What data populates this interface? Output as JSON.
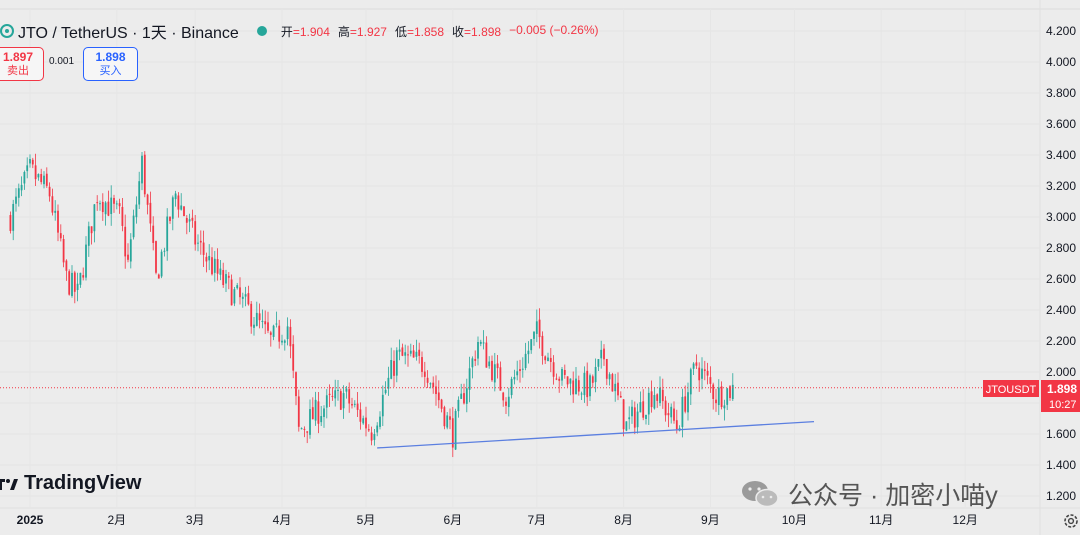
{
  "header": {
    "symbol": "JTO / TetherUS · 1天 · Binance",
    "ohlc": [
      {
        "label": "开",
        "value": "=1.904"
      },
      {
        "label": "高",
        "value": "=1.927"
      },
      {
        "label": "低",
        "value": "=1.858"
      },
      {
        "label": "收",
        "value": "=1.898"
      },
      {
        "label": "",
        "value": "−0.005 (−0.26%)"
      }
    ]
  },
  "trade": {
    "sell_price": "1.897",
    "sell_label": "卖出",
    "spread": "0.001",
    "buy_price": "1.898",
    "buy_label": "买入"
  },
  "price_tag": {
    "symbol": "JTOUSDT",
    "price": "1.898",
    "time": "10:27"
  },
  "branding": {
    "tradingview": "TradingView",
    "watermark": "公众号 · 加密小喵y"
  },
  "colors": {
    "up": "#26a69a",
    "down": "#f23645",
    "trendline": "#5b7fe0",
    "background": "#ececec"
  },
  "chart_data": {
    "type": "candlestick",
    "interval": "1天",
    "y_ticks": [
      4.2,
      4.0,
      3.8,
      3.6,
      3.4,
      3.2,
      3.0,
      2.8,
      2.6,
      2.4,
      2.2,
      2.0,
      1.8,
      1.6,
      1.4,
      1.2
    ],
    "y_tick_labels": [
      "4.200",
      "4.000",
      "3.800",
      "3.600",
      "3.400",
      "3.200",
      "3.000",
      "2.800",
      "2.600",
      "2.400",
      "2.200",
      "2.000",
      "1.800",
      "1.600",
      "1.400",
      "1.200"
    ],
    "x_labels": [
      {
        "label": "2025",
        "date": "2025-01-01"
      },
      {
        "label": "2月",
        "date": "2025-02-01"
      },
      {
        "label": "3月",
        "date": "2025-03-01"
      },
      {
        "label": "4月",
        "date": "2025-04-01"
      },
      {
        "label": "5月",
        "date": "2025-05-01"
      },
      {
        "label": "6月",
        "date": "2025-06-01"
      },
      {
        "label": "7月",
        "date": "2025-07-01"
      },
      {
        "label": "8月",
        "date": "2025-08-01"
      },
      {
        "label": "9月",
        "date": "2025-09-01"
      },
      {
        "label": "10月",
        "date": "2025-10-01"
      },
      {
        "label": "11月",
        "date": "2025-11-01"
      },
      {
        "label": "12月",
        "date": "2025-12-01"
      }
    ],
    "trendline": {
      "start": {
        "date": "2025-05-05",
        "value": 1.51
      },
      "end": {
        "date": "2025-10-08",
        "value": 1.68
      }
    },
    "last_price": 1.898,
    "anchors": [
      {
        "date": "2024-12-25",
        "close": 3.0
      },
      {
        "date": "2025-01-01",
        "close": 3.3
      },
      {
        "date": "2025-01-08",
        "close": 3.15
      },
      {
        "date": "2025-01-14",
        "close": 2.6
      },
      {
        "date": "2025-01-18",
        "close": 2.5
      },
      {
        "date": "2025-01-25",
        "close": 3.15
      },
      {
        "date": "2025-02-02",
        "close": 3.0
      },
      {
        "date": "2025-02-05",
        "close": 2.7
      },
      {
        "date": "2025-02-10",
        "close": 3.35
      },
      {
        "date": "2025-02-15",
        "close": 2.6
      },
      {
        "date": "2025-02-22",
        "close": 3.15
      },
      {
        "date": "2025-03-01",
        "close": 2.85
      },
      {
        "date": "2025-03-10",
        "close": 2.6
      },
      {
        "date": "2025-03-20",
        "close": 2.4
      },
      {
        "date": "2025-03-28",
        "close": 2.2
      },
      {
        "date": "2025-04-03",
        "close": 2.3
      },
      {
        "date": "2025-04-07",
        "close": 1.62
      },
      {
        "date": "2025-04-14",
        "close": 1.75
      },
      {
        "date": "2025-04-23",
        "close": 1.85
      },
      {
        "date": "2025-05-03",
        "close": 1.62
      },
      {
        "date": "2025-05-12",
        "close": 2.1
      },
      {
        "date": "2025-05-22",
        "close": 2.05
      },
      {
        "date": "2025-06-01",
        "close": 1.6
      },
      {
        "date": "2025-06-10",
        "close": 2.2
      },
      {
        "date": "2025-06-20",
        "close": 1.85
      },
      {
        "date": "2025-07-01",
        "close": 2.25
      },
      {
        "date": "2025-07-10",
        "close": 1.95
      },
      {
        "date": "2025-07-20",
        "close": 1.9
      },
      {
        "date": "2025-07-25",
        "close": 2.1
      },
      {
        "date": "2025-08-02",
        "close": 1.65
      },
      {
        "date": "2025-08-12",
        "close": 1.88
      },
      {
        "date": "2025-08-20",
        "close": 1.65
      },
      {
        "date": "2025-08-27",
        "close": 2.05
      },
      {
        "date": "2025-09-03",
        "close": 1.85
      },
      {
        "date": "2025-09-10",
        "close": 1.898
      }
    ]
  }
}
